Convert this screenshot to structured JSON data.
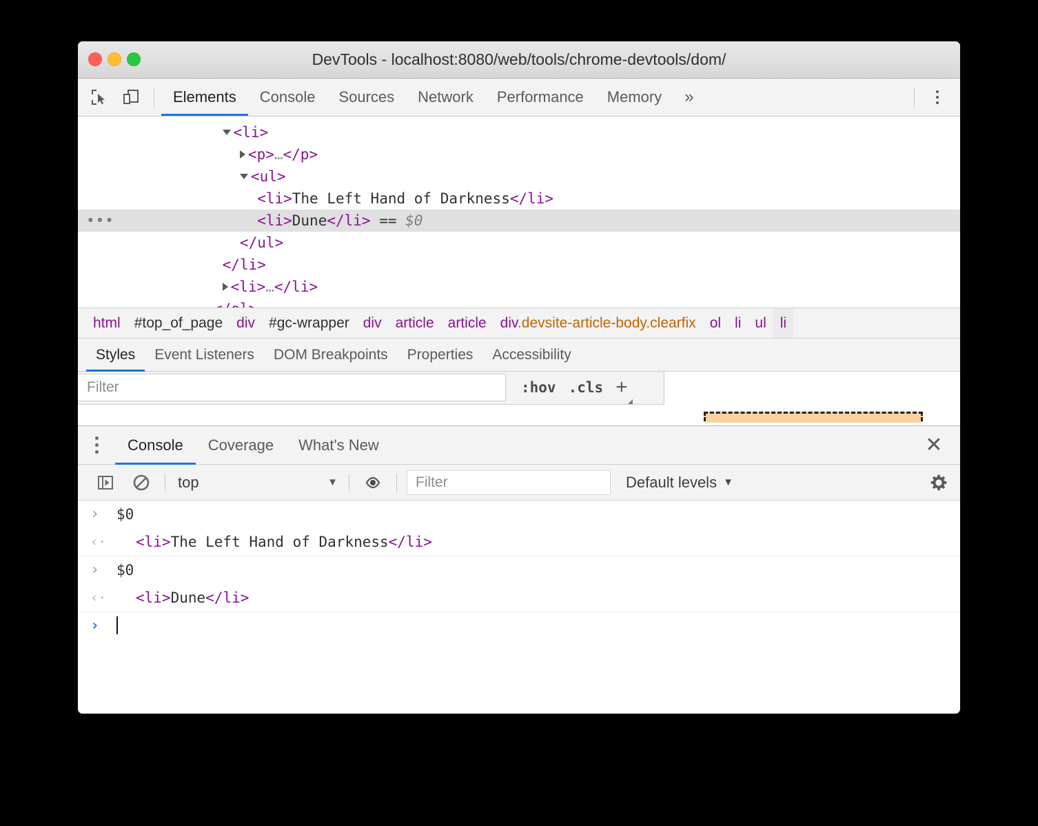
{
  "window": {
    "title": "DevTools - localhost:8080/web/tools/chrome-devtools/dom/",
    "traffic_lights": [
      "close-red",
      "minimize-yellow",
      "zoom-green"
    ]
  },
  "main_toolbar": {
    "icons": [
      "inspect-element-icon",
      "device-toolbar-icon"
    ],
    "tabs": [
      {
        "label": "Elements",
        "active": true
      },
      {
        "label": "Console",
        "active": false
      },
      {
        "label": "Sources",
        "active": false
      },
      {
        "label": "Network",
        "active": false
      },
      {
        "label": "Performance",
        "active": false
      },
      {
        "label": "Memory",
        "active": false
      }
    ],
    "more_label": "»",
    "menu_icon": "kebab-menu-icon"
  },
  "dom_tree": {
    "rows": [
      {
        "indent": 9,
        "toggle": "open",
        "parts": [
          {
            "t": "tag",
            "v": "<li>"
          }
        ]
      },
      {
        "indent": 11,
        "toggle": "closed",
        "parts": [
          {
            "t": "tag",
            "v": "<p>"
          },
          {
            "t": "dim",
            "v": "…"
          },
          {
            "t": "tag",
            "v": "</p>"
          }
        ]
      },
      {
        "indent": 11,
        "toggle": "open",
        "parts": [
          {
            "t": "tag",
            "v": "<ul>"
          }
        ]
      },
      {
        "indent": 13,
        "toggle": "none",
        "parts": [
          {
            "t": "tag",
            "v": "<li>"
          },
          {
            "t": "txt",
            "v": "The Left Hand of Darkness"
          },
          {
            "t": "tag",
            "v": "</li>"
          }
        ]
      },
      {
        "indent": 13,
        "toggle": "none",
        "selected": true,
        "ellipsis": "…",
        "parts": [
          {
            "t": "tag",
            "v": "<li>"
          },
          {
            "t": "txt",
            "v": "Dune"
          },
          {
            "t": "tag",
            "v": "</li>"
          },
          {
            "t": "eq",
            "v": " == "
          },
          {
            "t": "sel",
            "v": "$0"
          }
        ]
      },
      {
        "indent": 11,
        "toggle": "none",
        "parts": [
          {
            "t": "tag",
            "v": "</ul>"
          }
        ]
      },
      {
        "indent": 9,
        "toggle": "none",
        "parts": [
          {
            "t": "tag",
            "v": "</li>"
          }
        ]
      },
      {
        "indent": 9,
        "toggle": "closed",
        "parts": [
          {
            "t": "tag",
            "v": "<li>"
          },
          {
            "t": "dim",
            "v": "…"
          },
          {
            "t": "tag",
            "v": "</li>"
          }
        ]
      },
      {
        "indent": 8,
        "toggle": "none",
        "parts": [
          {
            "t": "tag",
            "v": "</ol>"
          }
        ]
      }
    ]
  },
  "breadcrumb": {
    "items": [
      {
        "label": "html",
        "kind": "tag",
        "selected": false
      },
      {
        "label": "#top_of_page",
        "kind": "id",
        "selected": false
      },
      {
        "label": "div",
        "kind": "tag",
        "selected": false
      },
      {
        "label": "#gc-wrapper",
        "kind": "id",
        "selected": false
      },
      {
        "label": "div",
        "kind": "tag",
        "selected": false
      },
      {
        "label": "article",
        "kind": "tag",
        "selected": false
      },
      {
        "label": "article",
        "kind": "tag",
        "selected": false
      },
      {
        "label": "div.devsite-article-body.clearfix",
        "kind": "tag-class",
        "tag": "div",
        "classes": ".devsite-article-body.clearfix",
        "selected": false
      },
      {
        "label": "ol",
        "kind": "tag",
        "selected": false
      },
      {
        "label": "li",
        "kind": "tag",
        "selected": false
      },
      {
        "label": "ul",
        "kind": "tag",
        "selected": false
      },
      {
        "label": "li",
        "kind": "tag",
        "selected": true
      }
    ]
  },
  "styles_panel": {
    "tabs": [
      {
        "label": "Styles",
        "active": true
      },
      {
        "label": "Event Listeners",
        "active": false
      },
      {
        "label": "DOM Breakpoints",
        "active": false
      },
      {
        "label": "Properties",
        "active": false
      },
      {
        "label": "Accessibility",
        "active": false
      }
    ],
    "filter_placeholder": "Filter",
    "filter_value": "",
    "hov_label": ":hov",
    "cls_label": ".cls",
    "new_rule_label": "+",
    "box_model": {
      "margin_color": "#fad2a0",
      "border_style": "dashed",
      "border_color": "#222222"
    }
  },
  "drawer": {
    "menu_icon": "kebab-menu-icon",
    "tabs": [
      {
        "label": "Console",
        "active": true
      },
      {
        "label": "Coverage",
        "active": false
      },
      {
        "label": "What's New",
        "active": false
      }
    ],
    "close_label": "✕"
  },
  "console_toolbar": {
    "sidebar_icon": "console-sidebar-icon",
    "clear_icon": "clear-console-icon",
    "context_value": "top",
    "context_arrow": "▼",
    "eye_icon": "live-expression-icon",
    "filter_placeholder": "Filter",
    "filter_value": "",
    "levels_label": "Default levels",
    "levels_arrow": "▼",
    "settings_icon": "gear-icon"
  },
  "console_messages": [
    {
      "gutter": "›",
      "gutter_kind": "in",
      "indent": false,
      "parts": [
        {
          "t": "txt",
          "v": "$0"
        }
      ]
    },
    {
      "gutter": "‹·",
      "gutter_kind": "out",
      "indent": true,
      "divider": true,
      "parts": [
        {
          "t": "tag",
          "v": "<li>"
        },
        {
          "t": "txt",
          "v": "The Left Hand of Darkness"
        },
        {
          "t": "tag",
          "v": "</li>"
        }
      ]
    },
    {
      "gutter": "›",
      "gutter_kind": "in",
      "indent": false,
      "parts": [
        {
          "t": "txt",
          "v": "$0"
        }
      ]
    },
    {
      "gutter": "‹·",
      "gutter_kind": "out",
      "indent": true,
      "divider": true,
      "parts": [
        {
          "t": "tag",
          "v": "<li>"
        },
        {
          "t": "txt",
          "v": "Dune"
        },
        {
          "t": "tag",
          "v": "</li>"
        }
      ]
    }
  ],
  "console_prompt": {
    "gutter": "›",
    "value": ""
  },
  "colors": {
    "accent": "#1a73e8",
    "tag": "#881391",
    "class": "#c26401",
    "text": "#303030",
    "chrome_bg": "#f3f3f3",
    "selected_row": "#e0e0e0"
  }
}
